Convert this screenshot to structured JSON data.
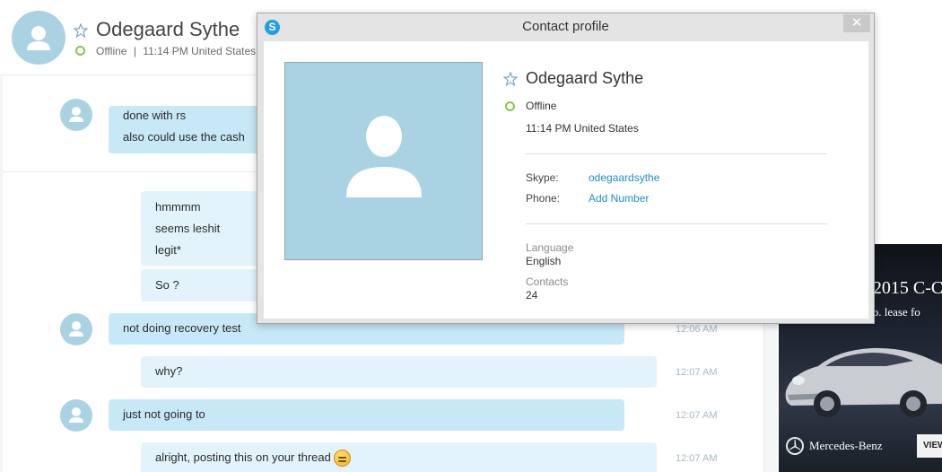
{
  "contact": {
    "name": "Odegaard Sythe",
    "status": "Offline",
    "separator": "|",
    "local_time": "11:14 PM United States"
  },
  "messages": [
    {
      "sender": "them",
      "lines": [
        "done with rs",
        "also could use the cash"
      ],
      "time": ""
    },
    {
      "sender": "me",
      "lines": [
        "hmmmm",
        "seems leshit",
        "legit*"
      ],
      "time": ""
    },
    {
      "sender": "me",
      "lines": [
        "So ?"
      ],
      "time": ""
    },
    {
      "sender": "them",
      "lines": [
        "not doing recovery test"
      ],
      "time": "12:06 AM"
    },
    {
      "sender": "me",
      "lines": [
        "why?"
      ],
      "time": "12:07 AM"
    },
    {
      "sender": "them",
      "lines": [
        "just not going to"
      ],
      "time": "12:07 AM"
    },
    {
      "sender": "me",
      "lines": [
        "alright, posting this on your thread"
      ],
      "time": "12:07 AM"
    }
  ],
  "profile_dialog": {
    "title": "Contact profile",
    "close_glyph": "✕",
    "skype_glyph": "S",
    "name": "Odegaard Sythe",
    "status": "Offline",
    "local_time": "11:14 PM United States",
    "skype_label": "Skype:",
    "skype_value": "odegaardsythe",
    "phone_label": "Phone:",
    "phone_value": "Add Number",
    "language_label": "Language",
    "language_value": "English",
    "contacts_label": "Contacts",
    "contacts_value": "24"
  },
  "ad": {
    "headline": "e 2015 C-C",
    "sub": "/mo. lease fo",
    "brand": "Mercedes-Benz",
    "button": "VIEW"
  },
  "icons": {
    "star": "star-outline-icon",
    "avatar": "default-person-icon",
    "status": "offline-status-icon",
    "emoji": "grimace-emoji-icon"
  },
  "colors": {
    "accent_link": "#1f8fc4",
    "avatar_bg": "#a9d3e3",
    "bubble_them": "#c7e8f7",
    "bubble_me": "#e2f3fb",
    "status_ring": "#8bc34a"
  }
}
